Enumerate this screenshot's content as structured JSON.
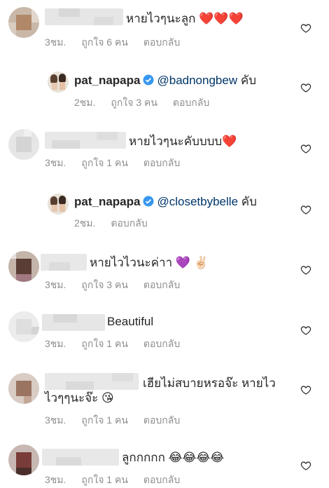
{
  "comments": [
    {
      "text": "หายไวๆนะลูก",
      "emoji": "❤️❤️❤️",
      "time": "3ชม.",
      "likes": "ถูกใจ 6 คน",
      "reply": "ตอบกลับ"
    },
    {
      "username": "pat_napapa",
      "mention": "@badnongbew",
      "text": "คับ",
      "time": "2ชม.",
      "likes": "ถูกใจ 3 คน",
      "reply": "ตอบกลับ"
    },
    {
      "text": "หายไวๆนะคับบบบ",
      "emoji": "❤️",
      "time": "3ชม.",
      "likes": "ถูกใจ 1 คน",
      "reply": "ตอบกลับ"
    },
    {
      "username": "pat_napapa",
      "mention": "@closetbybelle",
      "text": "คับ",
      "time": "2ชม.",
      "reply": "ตอบกลับ"
    },
    {
      "text": "หายไวไวนะค่าา",
      "emoji": "💜 ✌🏻",
      "time": "3ชม.",
      "likes": "ถูกใจ 3 คน",
      "reply": "ตอบกลับ"
    },
    {
      "text": "Beautiful",
      "time": "3ชม.",
      "likes": "ถูกใจ 1 คน",
      "reply": "ตอบกลับ"
    },
    {
      "text": "เฮียไม่สบายหรอจ๊ะ หายไว",
      "text2": "ไวๆๆนะจ๊ะ",
      "emoji": "😘",
      "time": "3ชม.",
      "likes": "ถูกใจ 1 คน",
      "reply": "ตอบกลับ"
    },
    {
      "text": "ลูกกกกก",
      "emoji": "😂😂😂😂",
      "time": "3ชม.",
      "likes": "ถูกใจ 1 คน",
      "reply": "ตอบกลับ"
    }
  ],
  "colors": {
    "meta": "#8e8e8e",
    "mention": "#003569",
    "text": "#262626"
  },
  "icons": {
    "like": "heart-icon",
    "verified": "verified-badge-icon"
  }
}
